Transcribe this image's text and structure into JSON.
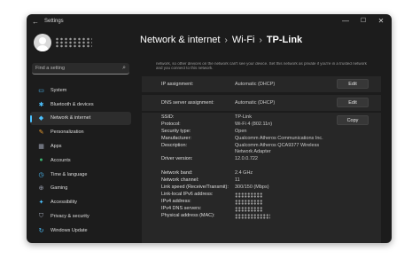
{
  "window": {
    "title": "Settings",
    "back_glyph": "←",
    "controls": {
      "minimize": "—",
      "maximize": "☐",
      "close": "✕"
    }
  },
  "user": {
    "name_redacted": true
  },
  "search": {
    "placeholder": "Find a setting",
    "icon": "search-icon"
  },
  "sidebar": {
    "items": [
      {
        "label": "System",
        "icon": "system-icon",
        "color": "#4cc2ff",
        "active": false
      },
      {
        "label": "Bluetooth & devices",
        "icon": "bluetooth-icon",
        "color": "#4cc2ff",
        "active": false
      },
      {
        "label": "Network & internet",
        "icon": "wifi-icon",
        "color": "#4cc2ff",
        "active": true
      },
      {
        "label": "Personalization",
        "icon": "brush-icon",
        "color": "#f0a030",
        "active": false
      },
      {
        "label": "Apps",
        "icon": "apps-icon",
        "color": "#9aa0b0",
        "active": false
      },
      {
        "label": "Accounts",
        "icon": "person-icon",
        "color": "#3cb371",
        "active": false
      },
      {
        "label": "Time & language",
        "icon": "globe-icon",
        "color": "#4cc2ff",
        "active": false
      },
      {
        "label": "Gaming",
        "icon": "controller-icon",
        "color": "#9aa0b0",
        "active": false
      },
      {
        "label": "Accessibility",
        "icon": "accessibility-icon",
        "color": "#4cc2ff",
        "active": false
      },
      {
        "label": "Privacy & security",
        "icon": "shield-icon",
        "color": "#9aa0b0",
        "active": false
      },
      {
        "label": "Windows Update",
        "icon": "update-icon",
        "color": "#4cc2ff",
        "active": false
      }
    ]
  },
  "breadcrumb": {
    "parts": [
      "Network & internet",
      "Wi-Fi",
      "TP-Link"
    ],
    "separator": "›"
  },
  "content": {
    "intro": "network, so other devices on the network can't see your device. Set this network as private if you're in a trusted network and you connect to this network.",
    "ip_assignment": {
      "label": "IP assignment:",
      "value": "Automatic (DHCP)",
      "button": "Edit"
    },
    "dns_assignment": {
      "label": "DNS server assignment:",
      "value": "Automatic (DHCP)",
      "button": "Edit"
    },
    "copy_button": "Copy",
    "properties": [
      {
        "label": "SSID:",
        "value": "TP-Link"
      },
      {
        "label": "Protocol:",
        "value": "Wi-Fi 4 (802.11n)"
      },
      {
        "label": "Security type:",
        "value": "Open"
      },
      {
        "label": "Manufacturer:",
        "value": "Qualcomm Atheros Communications Inc."
      },
      {
        "label": "Description:",
        "value": "Qualcomm Atheros QCA9377 Wireless",
        "value2": "Network Adapter"
      },
      {
        "label": "Driver version:",
        "value": "12.0.0.722"
      },
      {
        "label": "Network band:",
        "value": "2.4 GHz"
      },
      {
        "label": "Network channel:",
        "value": "11"
      },
      {
        "label": "Link speed (Receive/Transmit):",
        "value": "300/150 (Mbps)"
      },
      {
        "label": "Link-local IPv6 address:",
        "redacted": true
      },
      {
        "label": "IPv4 address:",
        "redacted": true
      },
      {
        "label": "IPv4 DNS servers:",
        "redacted": true
      },
      {
        "label": "Physical address (MAC):",
        "redacted": true
      }
    ]
  }
}
